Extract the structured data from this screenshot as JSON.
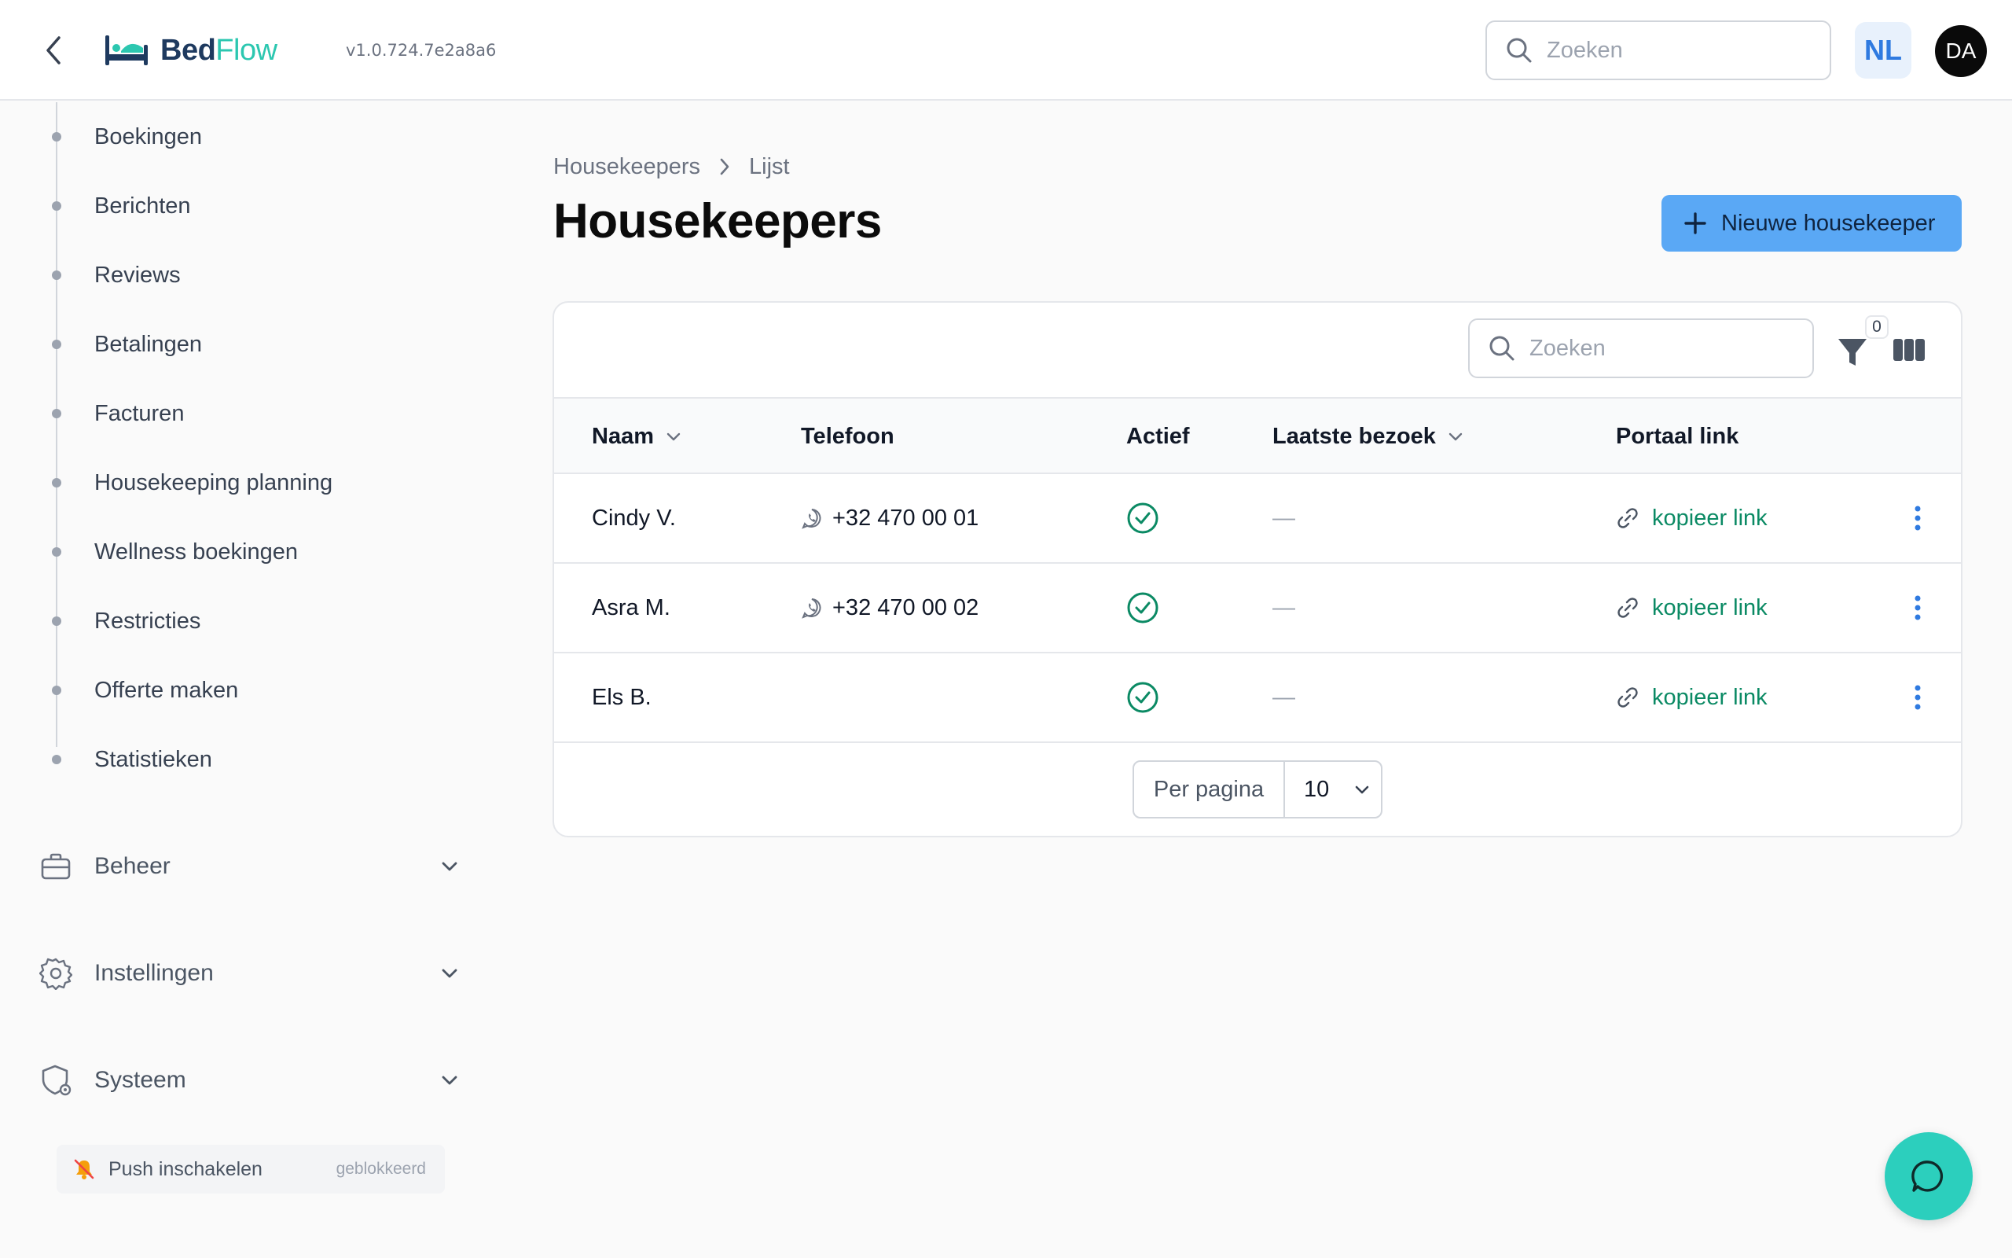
{
  "header": {
    "logo_part1": "Bed",
    "logo_part2": "Flow",
    "version": "v1.0.724.7e2a8a6",
    "search_placeholder": "Zoeken",
    "language": "NL",
    "avatar_initials": "DA"
  },
  "sidebar": {
    "items": [
      {
        "label": "Boekingen"
      },
      {
        "label": "Berichten"
      },
      {
        "label": "Reviews"
      },
      {
        "label": "Betalingen"
      },
      {
        "label": "Facturen"
      },
      {
        "label": "Housekeeping planning"
      },
      {
        "label": "Wellness boekingen"
      },
      {
        "label": "Restricties"
      },
      {
        "label": "Offerte maken"
      },
      {
        "label": "Statistieken"
      }
    ],
    "groups": [
      {
        "label": "Beheer",
        "icon": "briefcase-icon"
      },
      {
        "label": "Instellingen",
        "icon": "gear-icon"
      },
      {
        "label": "Systeem",
        "icon": "shield-gear-icon"
      }
    ],
    "push": {
      "label": "Push inschakelen",
      "status": "geblokkeerd"
    }
  },
  "breadcrumb": {
    "parent": "Housekeepers",
    "current": "Lijst"
  },
  "page_title": "Housekeepers",
  "new_button": "Nieuwe housekeeper",
  "table": {
    "search_placeholder": "Zoeken",
    "filter_count": "0",
    "columns": {
      "name": "Naam",
      "phone": "Telefoon",
      "active": "Actief",
      "last_visit": "Laatste bezoek",
      "portal": "Portaal link"
    },
    "rows": [
      {
        "name": "Cindy V.",
        "phone": "+32 470 00 01",
        "active": true,
        "last_visit": "—",
        "portal": "kopieer link"
      },
      {
        "name": "Asra M.",
        "phone": "+32 470 00 02",
        "active": true,
        "last_visit": "—",
        "portal": "kopieer link"
      },
      {
        "name": "Els B.",
        "phone": "",
        "active": true,
        "last_visit": "—",
        "portal": "kopieer link"
      }
    ],
    "per_page_label": "Per pagina",
    "per_page_value": "10"
  },
  "colors": {
    "primary": "#5aa8f5",
    "success": "#0b8a64",
    "fab": "#2ccfbd",
    "logo_dark": "#1e3a5f",
    "logo_teal": "#2cc7b0"
  }
}
